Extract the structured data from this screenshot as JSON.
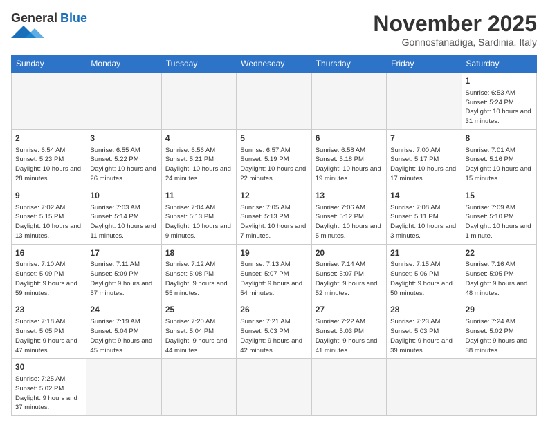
{
  "logo": {
    "text_general": "General",
    "text_blue": "Blue"
  },
  "header": {
    "month": "November 2025",
    "location": "Gonnosfanadiga, Sardinia, Italy"
  },
  "weekdays": [
    "Sunday",
    "Monday",
    "Tuesday",
    "Wednesday",
    "Thursday",
    "Friday",
    "Saturday"
  ],
  "weeks": [
    [
      {
        "day": "",
        "info": "",
        "empty": true
      },
      {
        "day": "",
        "info": "",
        "empty": true
      },
      {
        "day": "",
        "info": "",
        "empty": true
      },
      {
        "day": "",
        "info": "",
        "empty": true
      },
      {
        "day": "",
        "info": "",
        "empty": true
      },
      {
        "day": "",
        "info": "",
        "empty": true
      },
      {
        "day": "1",
        "info": "Sunrise: 6:53 AM\nSunset: 5:24 PM\nDaylight: 10 hours and 31 minutes.",
        "empty": false
      }
    ],
    [
      {
        "day": "2",
        "info": "Sunrise: 6:54 AM\nSunset: 5:23 PM\nDaylight: 10 hours and 28 minutes.",
        "empty": false
      },
      {
        "day": "3",
        "info": "Sunrise: 6:55 AM\nSunset: 5:22 PM\nDaylight: 10 hours and 26 minutes.",
        "empty": false
      },
      {
        "day": "4",
        "info": "Sunrise: 6:56 AM\nSunset: 5:21 PM\nDaylight: 10 hours and 24 minutes.",
        "empty": false
      },
      {
        "day": "5",
        "info": "Sunrise: 6:57 AM\nSunset: 5:19 PM\nDaylight: 10 hours and 22 minutes.",
        "empty": false
      },
      {
        "day": "6",
        "info": "Sunrise: 6:58 AM\nSunset: 5:18 PM\nDaylight: 10 hours and 19 minutes.",
        "empty": false
      },
      {
        "day": "7",
        "info": "Sunrise: 7:00 AM\nSunset: 5:17 PM\nDaylight: 10 hours and 17 minutes.",
        "empty": false
      },
      {
        "day": "8",
        "info": "Sunrise: 7:01 AM\nSunset: 5:16 PM\nDaylight: 10 hours and 15 minutes.",
        "empty": false
      }
    ],
    [
      {
        "day": "9",
        "info": "Sunrise: 7:02 AM\nSunset: 5:15 PM\nDaylight: 10 hours and 13 minutes.",
        "empty": false
      },
      {
        "day": "10",
        "info": "Sunrise: 7:03 AM\nSunset: 5:14 PM\nDaylight: 10 hours and 11 minutes.",
        "empty": false
      },
      {
        "day": "11",
        "info": "Sunrise: 7:04 AM\nSunset: 5:13 PM\nDaylight: 10 hours and 9 minutes.",
        "empty": false
      },
      {
        "day": "12",
        "info": "Sunrise: 7:05 AM\nSunset: 5:13 PM\nDaylight: 10 hours and 7 minutes.",
        "empty": false
      },
      {
        "day": "13",
        "info": "Sunrise: 7:06 AM\nSunset: 5:12 PM\nDaylight: 10 hours and 5 minutes.",
        "empty": false
      },
      {
        "day": "14",
        "info": "Sunrise: 7:08 AM\nSunset: 5:11 PM\nDaylight: 10 hours and 3 minutes.",
        "empty": false
      },
      {
        "day": "15",
        "info": "Sunrise: 7:09 AM\nSunset: 5:10 PM\nDaylight: 10 hours and 1 minute.",
        "empty": false
      }
    ],
    [
      {
        "day": "16",
        "info": "Sunrise: 7:10 AM\nSunset: 5:09 PM\nDaylight: 9 hours and 59 minutes.",
        "empty": false
      },
      {
        "day": "17",
        "info": "Sunrise: 7:11 AM\nSunset: 5:09 PM\nDaylight: 9 hours and 57 minutes.",
        "empty": false
      },
      {
        "day": "18",
        "info": "Sunrise: 7:12 AM\nSunset: 5:08 PM\nDaylight: 9 hours and 55 minutes.",
        "empty": false
      },
      {
        "day": "19",
        "info": "Sunrise: 7:13 AM\nSunset: 5:07 PM\nDaylight: 9 hours and 54 minutes.",
        "empty": false
      },
      {
        "day": "20",
        "info": "Sunrise: 7:14 AM\nSunset: 5:07 PM\nDaylight: 9 hours and 52 minutes.",
        "empty": false
      },
      {
        "day": "21",
        "info": "Sunrise: 7:15 AM\nSunset: 5:06 PM\nDaylight: 9 hours and 50 minutes.",
        "empty": false
      },
      {
        "day": "22",
        "info": "Sunrise: 7:16 AM\nSunset: 5:05 PM\nDaylight: 9 hours and 48 minutes.",
        "empty": false
      }
    ],
    [
      {
        "day": "23",
        "info": "Sunrise: 7:18 AM\nSunset: 5:05 PM\nDaylight: 9 hours and 47 minutes.",
        "empty": false
      },
      {
        "day": "24",
        "info": "Sunrise: 7:19 AM\nSunset: 5:04 PM\nDaylight: 9 hours and 45 minutes.",
        "empty": false
      },
      {
        "day": "25",
        "info": "Sunrise: 7:20 AM\nSunset: 5:04 PM\nDaylight: 9 hours and 44 minutes.",
        "empty": false
      },
      {
        "day": "26",
        "info": "Sunrise: 7:21 AM\nSunset: 5:03 PM\nDaylight: 9 hours and 42 minutes.",
        "empty": false
      },
      {
        "day": "27",
        "info": "Sunrise: 7:22 AM\nSunset: 5:03 PM\nDaylight: 9 hours and 41 minutes.",
        "empty": false
      },
      {
        "day": "28",
        "info": "Sunrise: 7:23 AM\nSunset: 5:03 PM\nDaylight: 9 hours and 39 minutes.",
        "empty": false
      },
      {
        "day": "29",
        "info": "Sunrise: 7:24 AM\nSunset: 5:02 PM\nDaylight: 9 hours and 38 minutes.",
        "empty": false
      }
    ],
    [
      {
        "day": "30",
        "info": "Sunrise: 7:25 AM\nSunset: 5:02 PM\nDaylight: 9 hours and 37 minutes.",
        "empty": false
      },
      {
        "day": "",
        "info": "",
        "empty": true
      },
      {
        "day": "",
        "info": "",
        "empty": true
      },
      {
        "day": "",
        "info": "",
        "empty": true
      },
      {
        "day": "",
        "info": "",
        "empty": true
      },
      {
        "day": "",
        "info": "",
        "empty": true
      },
      {
        "day": "",
        "info": "",
        "empty": true
      }
    ]
  ]
}
